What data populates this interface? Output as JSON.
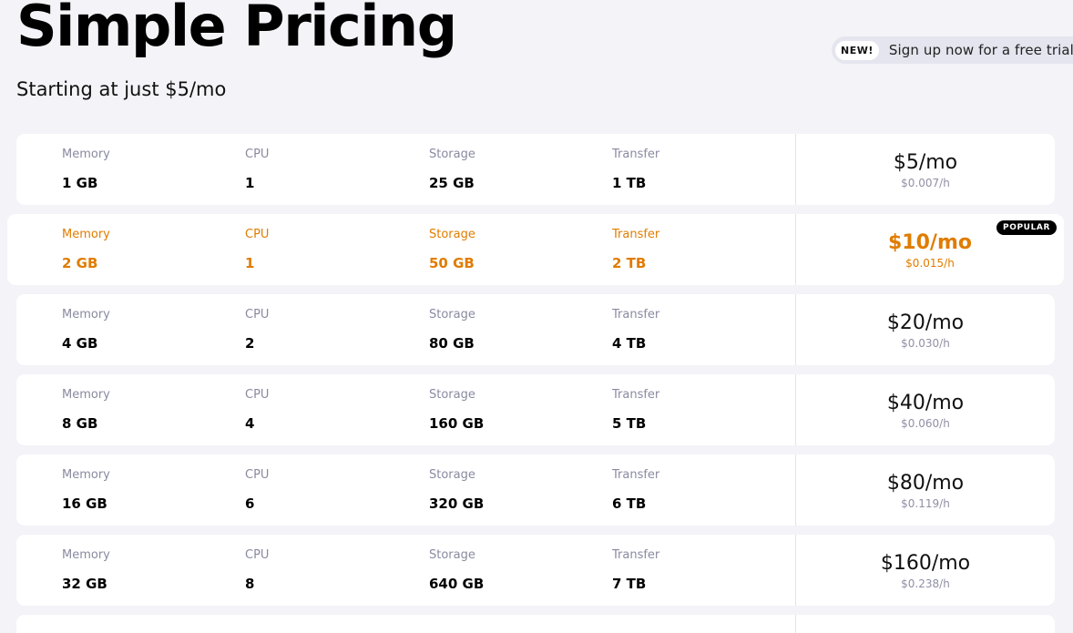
{
  "header": {
    "title": "Simple Pricing",
    "subtitle": "Starting at just $5/mo"
  },
  "promo": {
    "badge": "NEW!",
    "text": "Sign up now for a free trial"
  },
  "labels": {
    "memory": "Memory",
    "cpu": "CPU",
    "storage": "Storage",
    "transfer": "Transfer",
    "popular_badge": "POPULAR"
  },
  "colors": {
    "accent": "#e07c00",
    "background": "#f3f3f8"
  },
  "plans": [
    {
      "memory": "1 GB",
      "cpu": "1",
      "storage": "25 GB",
      "transfer": "1 TB",
      "price": "$5/mo",
      "hourly": "$0.007/h",
      "popular": false
    },
    {
      "memory": "2 GB",
      "cpu": "1",
      "storage": "50 GB",
      "transfer": "2 TB",
      "price": "$10/mo",
      "hourly": "$0.015/h",
      "popular": true
    },
    {
      "memory": "4 GB",
      "cpu": "2",
      "storage": "80 GB",
      "transfer": "4 TB",
      "price": "$20/mo",
      "hourly": "$0.030/h",
      "popular": false
    },
    {
      "memory": "8 GB",
      "cpu": "4",
      "storage": "160 GB",
      "transfer": "5 TB",
      "price": "$40/mo",
      "hourly": "$0.060/h",
      "popular": false
    },
    {
      "memory": "16 GB",
      "cpu": "6",
      "storage": "320 GB",
      "transfer": "6 TB",
      "price": "$80/mo",
      "hourly": "$0.119/h",
      "popular": false
    },
    {
      "memory": "32 GB",
      "cpu": "8",
      "storage": "640 GB",
      "transfer": "7 TB",
      "price": "$160/mo",
      "hourly": "$0.238/h",
      "popular": false
    }
  ]
}
